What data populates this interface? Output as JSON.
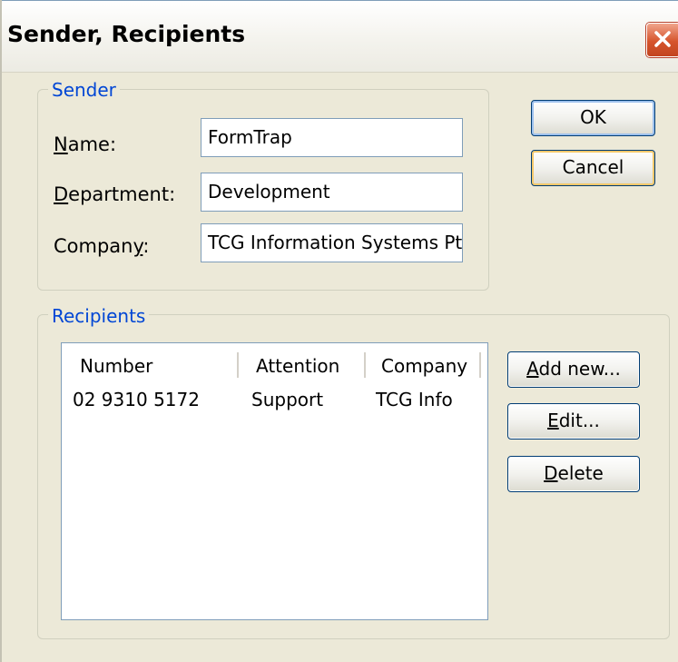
{
  "window": {
    "title": "Sender, Recipients",
    "close_icon": "close-icon"
  },
  "sender": {
    "legend": "Sender",
    "name_label_pre": "",
    "name_label_key": "N",
    "name_label_post": "ame:",
    "name_value": "FormTrap",
    "department_label_key": "D",
    "department_label_post": "epartment:",
    "department_value": "Development",
    "company_label_pre": "Compan",
    "company_label_key": "y",
    "company_label_post": ":",
    "company_value": "TCG Information Systems Pty"
  },
  "dialog_buttons": {
    "ok_label": "OK",
    "cancel_label": "Cancel"
  },
  "recipients": {
    "legend": "Recipients",
    "columns": [
      "Number",
      "Attention",
      "Company"
    ],
    "rows": [
      {
        "number": "02 9310 5172",
        "attention": "Support",
        "company": "TCG Info"
      }
    ],
    "add_key": "A",
    "add_post": "dd new...",
    "edit_key": "E",
    "edit_post": "dit...",
    "delete_key": "D",
    "delete_post": "elete"
  },
  "colors": {
    "dialog_bg": "#ece9d8",
    "group_legend": "#0046d5",
    "close_button": "#d6542c",
    "field_border": "#7f9db9"
  }
}
